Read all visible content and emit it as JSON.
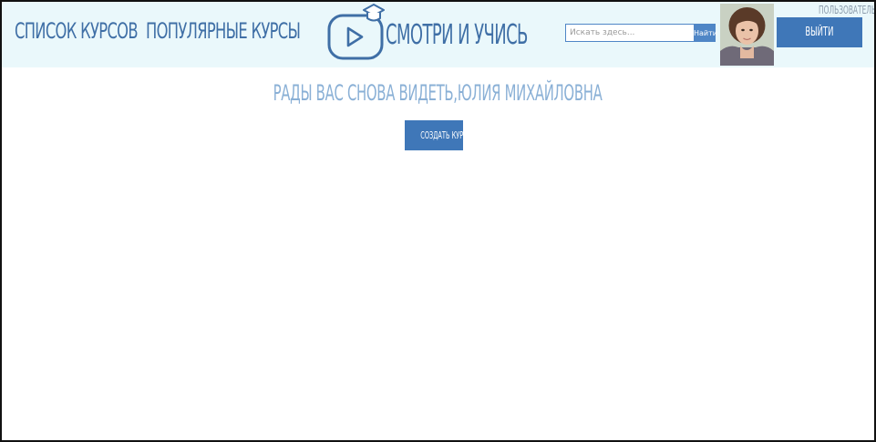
{
  "nav": {
    "courses_label": "Список курсов",
    "popular_label": "Популярные курсы"
  },
  "logo": {
    "text": "Смотри и учись",
    "icon": "play-video-graduation-cap-icon"
  },
  "search": {
    "placeholder": "Искать здесь...",
    "value": "",
    "button_label": "Найти"
  },
  "user": {
    "label": "Пользователь: w",
    "avatar": "user-photo",
    "logout_label": "Выйти"
  },
  "main": {
    "welcome_text": "Рады вас снова видеть,Юлия Михайловна",
    "create_course_label": "Создать курс"
  },
  "colors": {
    "header_bg": "#eaf8fb",
    "link_text": "#3f6fa6",
    "accent": "#3f77b8",
    "welcome_text": "#8ab0d6",
    "search_border": "#4f86c6"
  }
}
